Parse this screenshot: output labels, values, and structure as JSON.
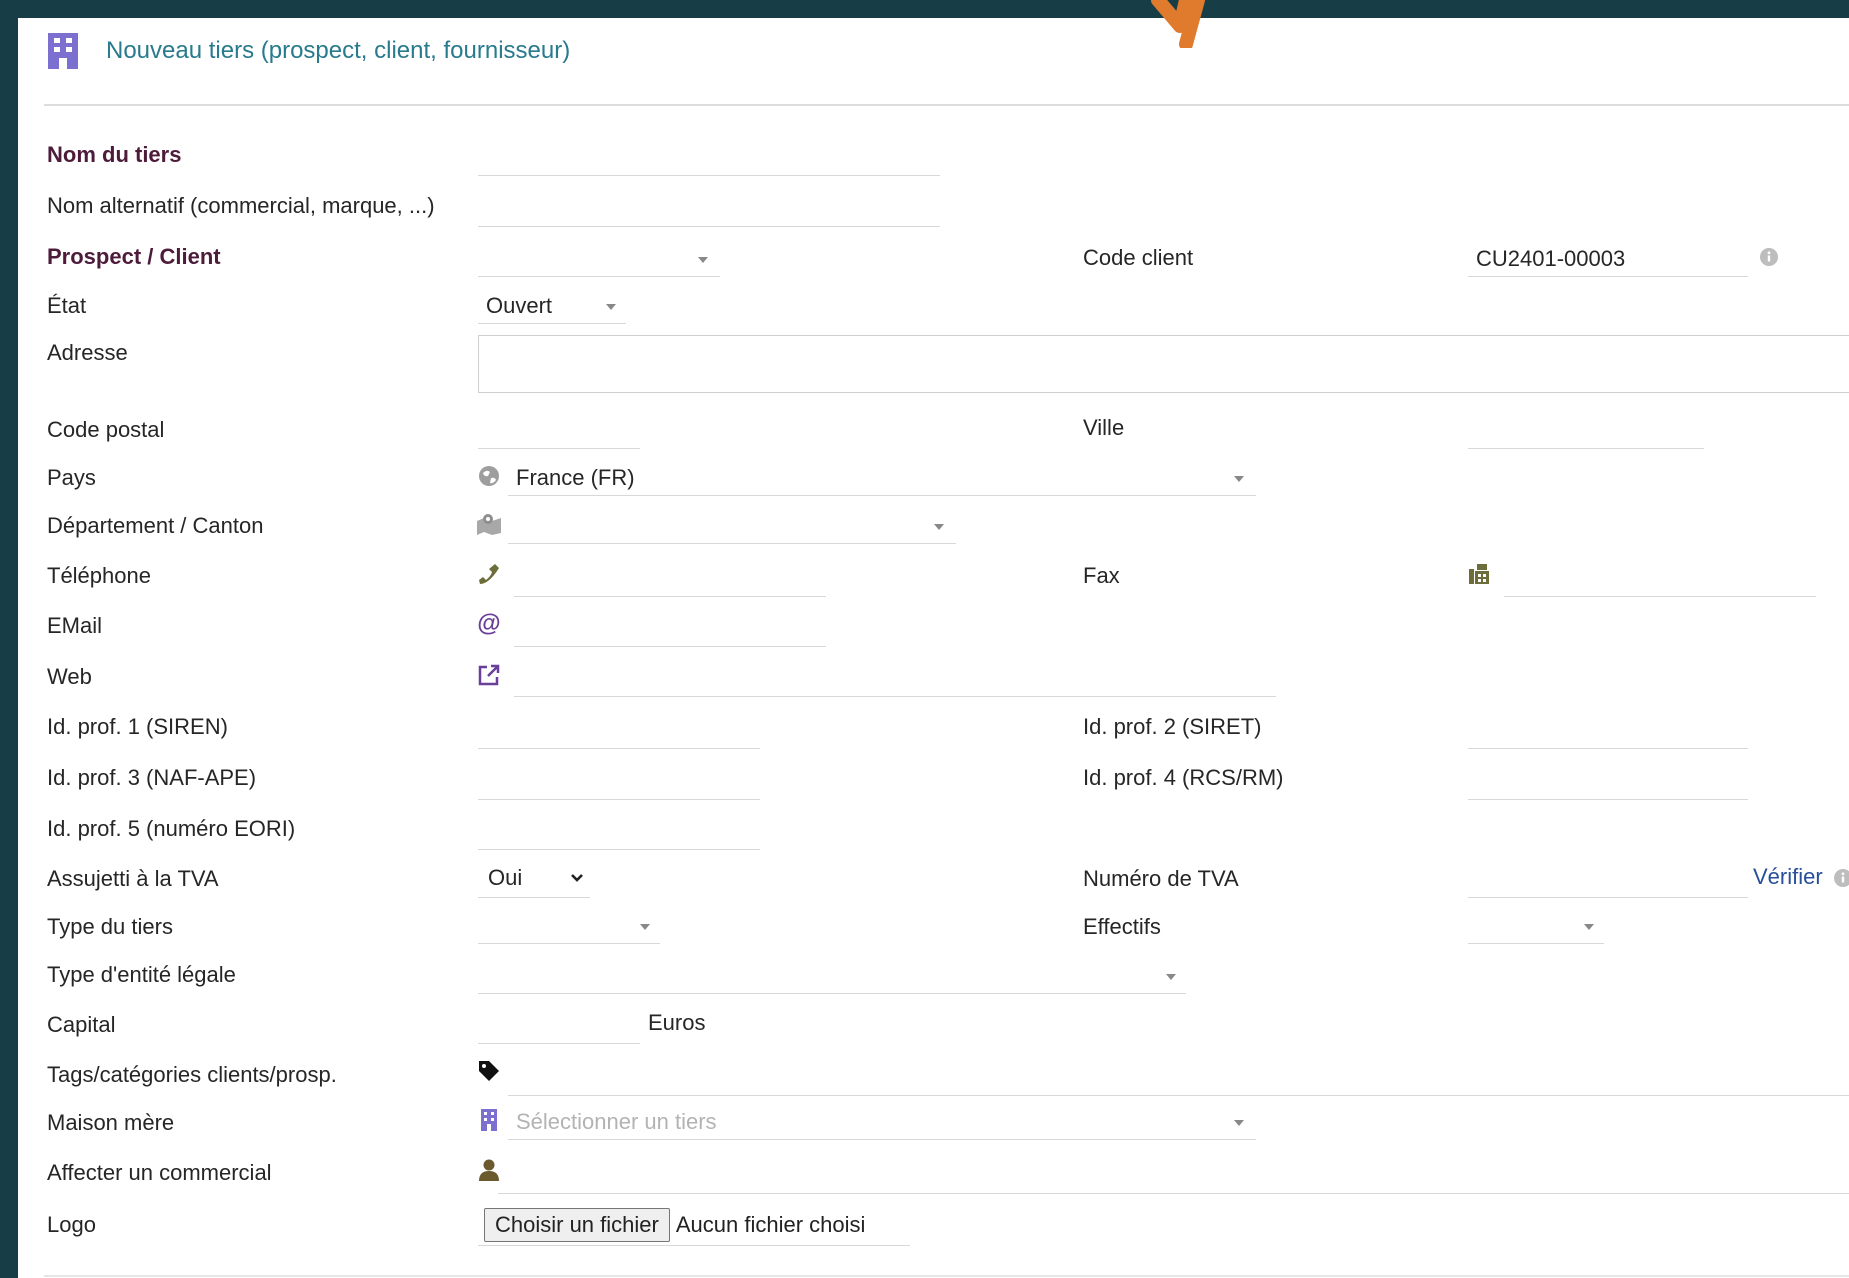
{
  "header": {
    "title": "Nouveau tiers (prospect, client, fournisseur)",
    "icon": "building-icon",
    "accent": "#287a8c"
  },
  "form": {
    "nom_du_tiers": {
      "label": "Nom du tiers",
      "value": ""
    },
    "nom_alternatif": {
      "label": "Nom alternatif (commercial, marque, ...)",
      "value": ""
    },
    "prospect_client": {
      "label": "Prospect / Client",
      "value": ""
    },
    "code_client": {
      "label": "Code client",
      "value": "CU2401-00003"
    },
    "etat": {
      "label": "État",
      "value": "Ouvert"
    },
    "adresse": {
      "label": "Adresse",
      "value": ""
    },
    "code_postal": {
      "label": "Code postal",
      "value": ""
    },
    "ville": {
      "label": "Ville",
      "value": ""
    },
    "pays": {
      "label": "Pays",
      "value": "France (FR)"
    },
    "departement": {
      "label": "Département / Canton",
      "value": ""
    },
    "telephone": {
      "label": "Téléphone",
      "value": ""
    },
    "fax": {
      "label": "Fax",
      "value": ""
    },
    "email": {
      "label": "EMail",
      "value": ""
    },
    "web": {
      "label": "Web",
      "value": ""
    },
    "idprof1": {
      "label": "Id. prof. 1 (SIREN)",
      "value": ""
    },
    "idprof2": {
      "label": "Id. prof. 2 (SIRET)",
      "value": ""
    },
    "idprof3": {
      "label": "Id. prof. 3 (NAF-APE)",
      "value": ""
    },
    "idprof4": {
      "label": "Id. prof. 4 (RCS/RM)",
      "value": ""
    },
    "idprof5": {
      "label": "Id. prof. 5 (numéro EORI)",
      "value": ""
    },
    "assujetti_tva": {
      "label": "Assujetti à la TVA",
      "value": "Oui"
    },
    "numero_tva": {
      "label": "Numéro de TVA",
      "value": "",
      "verify_link": "Vérifier"
    },
    "type_tiers": {
      "label": "Type du tiers",
      "value": ""
    },
    "effectifs": {
      "label": "Effectifs",
      "value": ""
    },
    "type_entite": {
      "label": "Type d'entité légale",
      "value": ""
    },
    "capital": {
      "label": "Capital",
      "value": "",
      "unit": "Euros"
    },
    "tags": {
      "label": "Tags/catégories clients/prosp.",
      "value": ""
    },
    "maison_mere": {
      "label": "Maison mère",
      "placeholder": "Sélectionner un tiers"
    },
    "commercial": {
      "label": "Affecter un commercial",
      "value": ""
    },
    "logo": {
      "label": "Logo",
      "button": "Choisir un fichier",
      "status": "Aucun fichier choisi"
    }
  },
  "colors": {
    "frame": "#173d47",
    "required_label": "#4d1c3a",
    "link": "#284f9a",
    "arrow": "#e07a2c"
  }
}
